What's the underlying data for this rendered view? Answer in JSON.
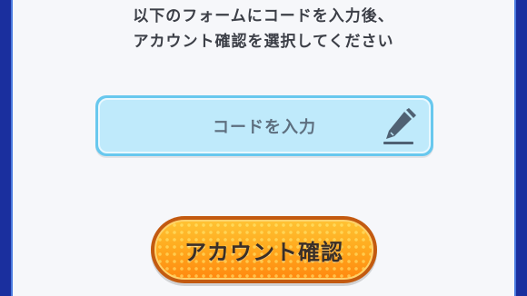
{
  "instructions": {
    "line1": "以下のフォームにコードを入力後、",
    "line2": "アカウント確認を選択してください"
  },
  "code_input": {
    "placeholder": "コードを入力",
    "icon": "pencil-icon"
  },
  "confirm_button": {
    "label": "アカウント確認"
  },
  "colors": {
    "background_frame": "#1a2f9e",
    "panel": "#f6f7fa",
    "input_border": "#68c8ee",
    "input_fill": "#bfeafb",
    "button_orange": "#ffab1f",
    "button_border": "#c35a10"
  }
}
